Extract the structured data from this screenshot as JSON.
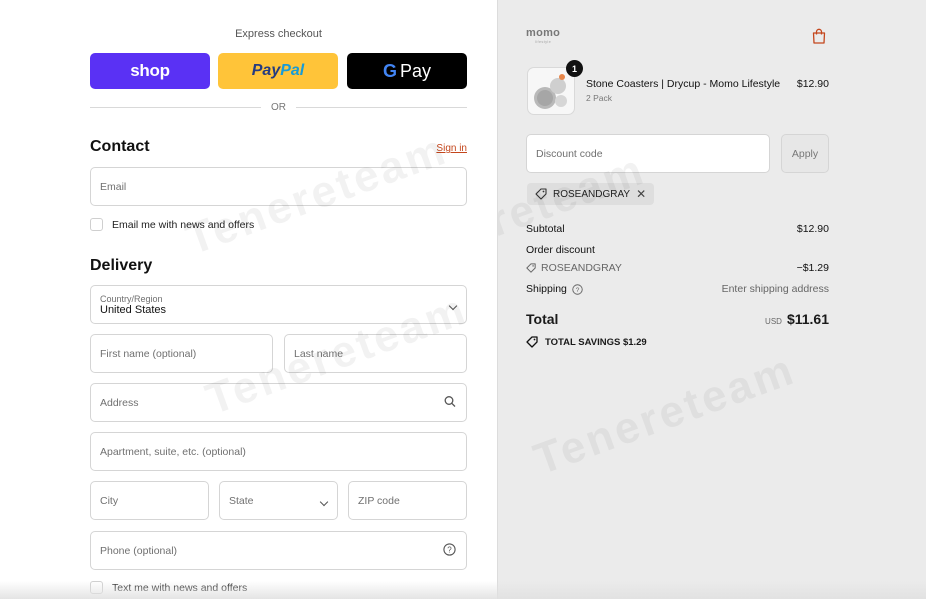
{
  "express": {
    "label": "Express checkout",
    "shop": "shop",
    "paypal_a": "Pay",
    "paypal_b": "Pal",
    "gpay_g": "G",
    "gpay": "Pay",
    "or": "OR"
  },
  "contact": {
    "title": "Contact",
    "sign_in": "Sign in",
    "email_placeholder": "Email",
    "email_news": "Email me with news and offers"
  },
  "delivery": {
    "title": "Delivery",
    "country_label": "Country/Region",
    "country_value": "United States",
    "first_name": "First name (optional)",
    "last_name": "Last name",
    "address": "Address",
    "apartment": "Apartment, suite, etc. (optional)",
    "city": "City",
    "state": "State",
    "zip": "ZIP code",
    "phone": "Phone (optional)",
    "text_news": "Text me with news and offers"
  },
  "summary": {
    "logo": "momo",
    "logo_sub": "lifestyle",
    "product": {
      "name": "Stone Coasters | Drycup - Momo Lifestyle",
      "variant": "2 Pack",
      "price": "$12.90",
      "quantity": "1"
    },
    "discount_placeholder": "Discount code",
    "apply": "Apply",
    "code": "ROSEANDGRAY",
    "subtotal_label": "Subtotal",
    "subtotal_value": "$12.90",
    "order_discount_label": "Order discount",
    "discount_code_label": "ROSEANDGRAY",
    "discount_value": "−$1.29",
    "shipping_label": "Shipping",
    "shipping_value": "Enter shipping address",
    "total_label": "Total",
    "currency": "USD",
    "total_value": "$11.61",
    "savings": "TOTAL SAVINGS  $1.29"
  },
  "watermark": "Tenereteam",
  "colors": {
    "shop": "#5a31f4",
    "paypal": "#ffc439",
    "gpay": "#000000",
    "link": "#c4461c"
  }
}
